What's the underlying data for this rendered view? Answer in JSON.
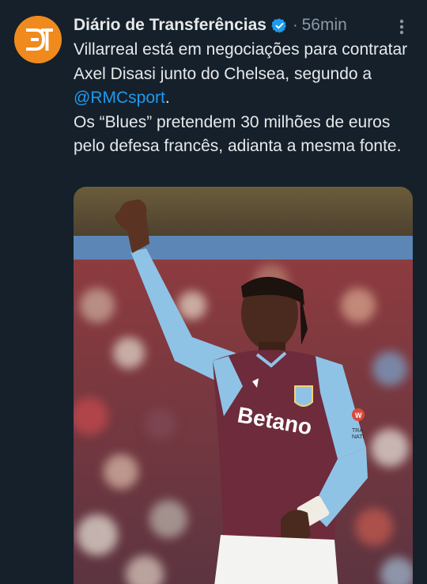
{
  "tweet": {
    "author_name": "Diário de Transferências",
    "separator": "·",
    "time": "56min",
    "avatar_icon": "dt-logo-avatar",
    "verified_icon": "verified-badge-icon",
    "more_icon": "more-options-icon",
    "line1": "Villarreal está em negociações para contratar Axel Disasi junto do Chelsea, segundo a ",
    "mention": "@RMCsport",
    "line1_end": ".",
    "line2": "Os “Blues” pretendem 30 milhões de euros pelo defesa francês, adianta a mesma fonte.",
    "photo": {
      "shirt_sponsor": "Betano",
      "sleeve_badge": "W",
      "sleeve_text_1": "TRA",
      "sleeve_text_2": "NATI"
    }
  },
  "colors": {
    "background": "#15202b",
    "text": "#e7e9ea",
    "muted": "#8b98a5",
    "link": "#1d9bf0",
    "avatar": "#f08a1c"
  }
}
